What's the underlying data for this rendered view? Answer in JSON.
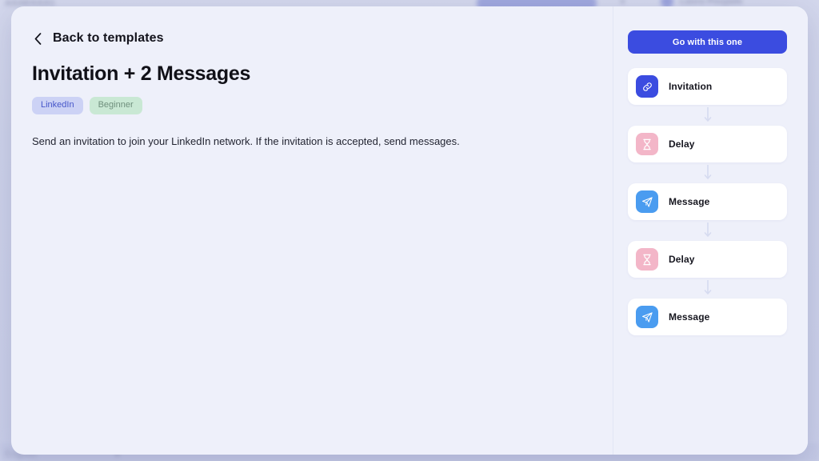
{
  "background": {
    "top_left_text": "AAAEAAA1",
    "top_right_user": "Laura Poujade",
    "bottom_left_language": "English",
    "chevron_icon": "chevron-down-icon"
  },
  "modal": {
    "back": {
      "label": "Back to templates",
      "icon": "chevron-left-icon"
    },
    "title": "Invitation + 2 Messages",
    "badges": [
      {
        "label": "LinkedIn",
        "color": "#4656c9",
        "background": "#ccd2f5"
      },
      {
        "label": "Beginner",
        "color": "#6f8f7d",
        "background": "#c9e8d4"
      }
    ],
    "description": "Send an invitation to join your LinkedIn network. If the invitation is accepted, send messages."
  },
  "sidebar": {
    "cta_label": "Go with this one",
    "cta_color": "#3b4ce0",
    "connector_icon": "arrow-down-icon",
    "steps": [
      {
        "label": "Invitation",
        "icon": "link-icon",
        "icon_color": "#3b4ce0"
      },
      {
        "label": "Delay",
        "icon": "hourglass-icon",
        "icon_color": "#f3b6c8"
      },
      {
        "label": "Message",
        "icon": "paper-plane-icon",
        "icon_color": "#4a9cf0"
      },
      {
        "label": "Delay",
        "icon": "hourglass-icon",
        "icon_color": "#f3b6c8"
      },
      {
        "label": "Message",
        "icon": "paper-plane-icon",
        "icon_color": "#4a9cf0"
      }
    ]
  }
}
